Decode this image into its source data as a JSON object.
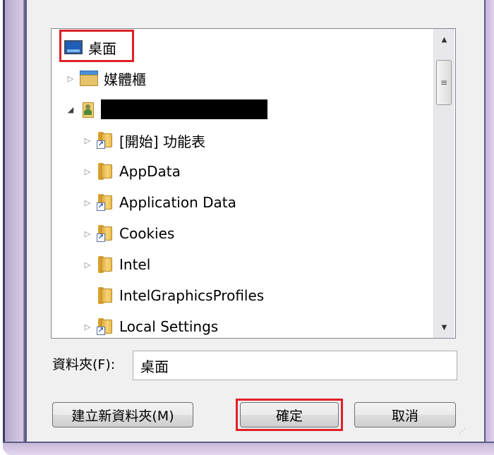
{
  "tree": {
    "desktop_label": "桌面",
    "items": [
      {
        "label": "媒體櫃",
        "expander": "collapsed",
        "icon": "library-icon"
      },
      {
        "label": "",
        "expander": "expanded",
        "icon": "user-folder-icon",
        "redacted": true
      },
      {
        "label": "[開始] 功能表",
        "expander": "collapsed",
        "icon": "folder-shortcut-icon"
      },
      {
        "label": "AppData",
        "expander": "collapsed",
        "icon": "folder-icon"
      },
      {
        "label": "Application Data",
        "expander": "collapsed",
        "icon": "folder-shortcut-icon"
      },
      {
        "label": "Cookies",
        "expander": "collapsed",
        "icon": "folder-shortcut-icon"
      },
      {
        "label": "Intel",
        "expander": "collapsed",
        "icon": "folder-icon"
      },
      {
        "label": "IntelGraphicsProfiles",
        "expander": "none",
        "icon": "folder-icon"
      },
      {
        "label": "Local Settings",
        "expander": "collapsed",
        "icon": "folder-shortcut-icon"
      }
    ]
  },
  "folder": {
    "label": "資料夾(F):",
    "value": "桌面"
  },
  "buttons": {
    "new_folder": "建立新資料夾(M)",
    "ok": "確定",
    "cancel": "取消"
  },
  "colors": {
    "highlight": "#e0202a",
    "frame": "#c7b4d8"
  }
}
